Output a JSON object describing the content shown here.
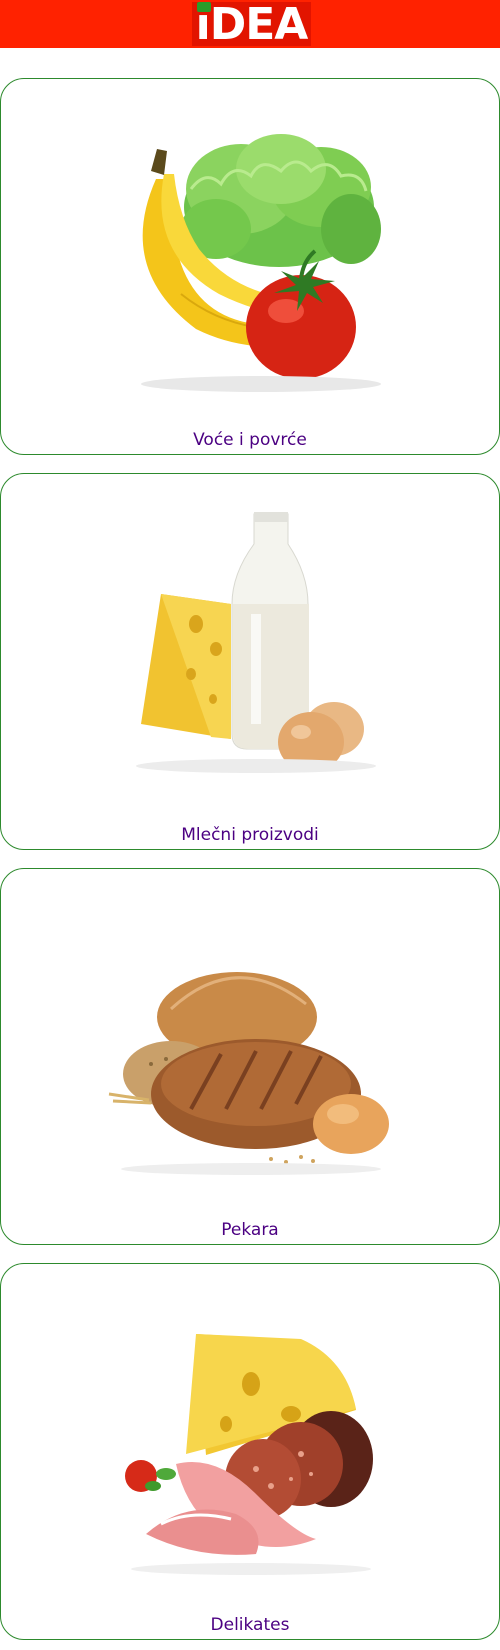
{
  "header": {
    "logo_text": "iDEA",
    "background_color": "#ff2200",
    "logo_dot_color": "#2a9d2a"
  },
  "categories": [
    {
      "label": "Voće i povrće",
      "icon": "fruit-vegetables-image"
    },
    {
      "label": "Mlečni proizvodi",
      "icon": "dairy-products-image"
    },
    {
      "label": "Pekara",
      "icon": "bakery-bread-image"
    },
    {
      "label": "Delikates",
      "icon": "deli-meats-cheese-image"
    }
  ],
  "colors": {
    "card_border": "#2d8a2d",
    "label_text": "#4b0082"
  }
}
